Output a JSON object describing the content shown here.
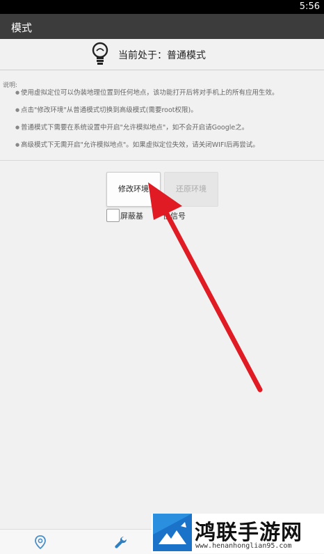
{
  "status_bar": {
    "time": "5:56"
  },
  "action_bar": {
    "title": "模式"
  },
  "mode": {
    "current_text": "当前处于：普通模式",
    "icon": "lightbulb-icon"
  },
  "description": {
    "heading": "说明:",
    "items": [
      "使用虚拟定位可以伪装地理位置到任何地点，该功能打开后将对手机上的所有应用生效。",
      "点击\"修改环境\"从普通模式切换到高级模式(需要root权限)。",
      "普通模式下需要在系统设置中开启\"允许模拟地点\"，如不会开启请Google之。",
      "高级模式下无需开启\"允许模拟地点\"。如果虚拟定位失效，请关闭WIFI后再尝试。"
    ]
  },
  "buttons": {
    "modify": "修改环境",
    "restore": "还原环境"
  },
  "checkbox": {
    "label": "屏蔽基",
    "label_tail": "位信号",
    "checked": false
  },
  "bottom_nav": {
    "items": [
      "location-pin-icon",
      "wrench-icon"
    ]
  },
  "watermark": {
    "title": "鸿联手游网",
    "url": "www.henanhonglian95.com"
  },
  "colors": {
    "action_bar": "#3c3c3c",
    "arrow": "#e01b24",
    "watermark_blue": "#1a73c9"
  }
}
